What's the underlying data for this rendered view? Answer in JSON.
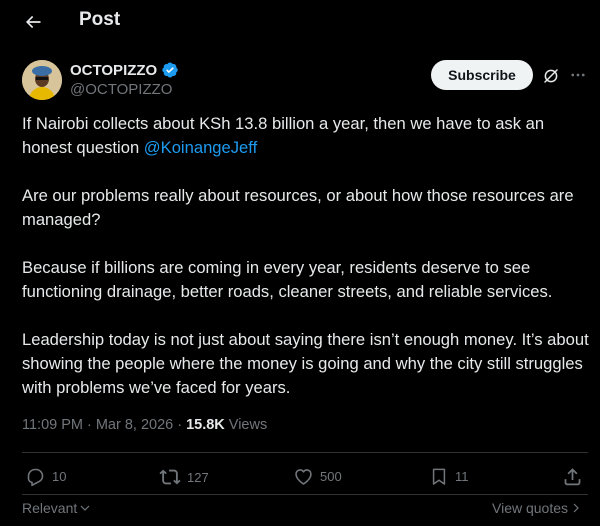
{
  "header": {
    "title": "Post",
    "back_icon": "arrow-left-icon"
  },
  "author": {
    "name": "OCTOPIZZO",
    "handle": "@OCTOPIZZO",
    "verified": true,
    "verified_color": "#1d9bf0"
  },
  "subscribe_label": "Subscribe",
  "tweet": {
    "p1_text": "If Nairobi collects about KSh 13.8 billion a year, then we have to ask an honest question ",
    "p1_mention": "@KoinangeJeff",
    "p2": "Are our problems really about resources, or about how those resources are managed?",
    "p3": "Because if billions are coming in every year, residents deserve to see functioning drainage, better roads, cleaner streets, and reliable services.",
    "p4": "Leadership today is not just about saying there isn’t enough money. It’s about showing the people where the money is going and why the city still struggles with problems we’ve faced for years."
  },
  "meta": {
    "time": "11:09 PM",
    "sep1": "·",
    "date": "Mar 8, 2026",
    "sep2": "·",
    "views_count": "15.8K",
    "views_label": "Views"
  },
  "actions": {
    "replies": "10",
    "reposts": "127",
    "likes": "500",
    "bookmarks": "11"
  },
  "footer": {
    "sort_label": "Relevant",
    "view_quotes_label": "View quotes"
  },
  "colors": {
    "background": "#000000",
    "text": "#e7e9ea",
    "muted": "#71767b",
    "accent": "#1d9bf0",
    "divider": "#2f3336"
  }
}
